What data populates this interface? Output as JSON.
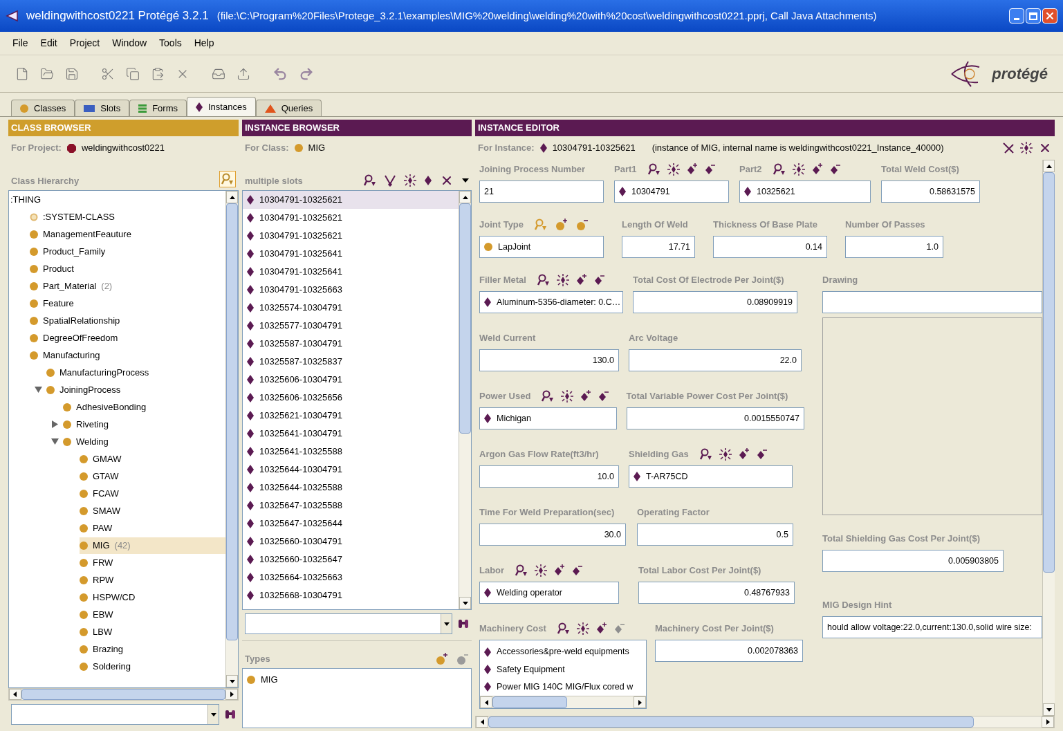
{
  "window": {
    "title": "weldingwithcost0221  Protégé 3.2.1",
    "path": "(file:\\C:\\Program%20Files\\Protege_3.2.1\\examples\\MIG%20welding\\welding%20with%20cost\\weldingwithcost0221.pprj, Call Java Attachments)"
  },
  "menu": [
    "File",
    "Edit",
    "Project",
    "Window",
    "Tools",
    "Help"
  ],
  "logo": "protégé",
  "tabs": [
    {
      "label": "Classes",
      "kind": "classes",
      "selected": false
    },
    {
      "label": "Slots",
      "kind": "slots",
      "selected": false
    },
    {
      "label": "Forms",
      "kind": "forms",
      "selected": false
    },
    {
      "label": "Instances",
      "kind": "instances",
      "selected": true
    },
    {
      "label": "Queries",
      "kind": "queries",
      "selected": false
    }
  ],
  "class_browser": {
    "title": "CLASS BROWSER",
    "for_label": "For Project:",
    "project": "weldingwithcost0221",
    "hierarchy_label": "Class Hierarchy",
    "tree": [
      {
        "label": ":THING",
        "selected": false,
        "children": [
          {
            "label": ":SYSTEM-CLASS",
            "kind": "system",
            "selected": false
          },
          {
            "label": "ManagementFeauture",
            "kind": "class",
            "selected": false
          },
          {
            "label": "Product_Family",
            "kind": "class",
            "selected": false
          },
          {
            "label": "Product",
            "kind": "class",
            "selected": false
          },
          {
            "label": "Part_Material",
            "count": "(2)",
            "kind": "class",
            "selected": false
          },
          {
            "label": "Feature",
            "kind": "class",
            "selected": false
          },
          {
            "label": "SpatialRelationship",
            "kind": "class",
            "selected": false
          },
          {
            "label": "DegreeOfFreedom",
            "kind": "class",
            "selected": false
          },
          {
            "label": "Manufacturing",
            "kind": "class",
            "selected": false,
            "children": [
              {
                "label": "ManufacturingProcess",
                "kind": "class",
                "selected": false
              },
              {
                "label": "JoiningProcess",
                "kind": "class",
                "selected": false,
                "expanded": true,
                "children": [
                  {
                    "label": "AdhesiveBonding",
                    "kind": "class",
                    "selected": false
                  },
                  {
                    "label": "Riveting",
                    "kind": "class",
                    "selected": false,
                    "expanded": false
                  },
                  {
                    "label": "Welding",
                    "kind": "class",
                    "selected": false,
                    "expanded": true,
                    "children": [
                      {
                        "label": "GMAW",
                        "kind": "class",
                        "selected": false
                      },
                      {
                        "label": "GTAW",
                        "kind": "class",
                        "selected": false
                      },
                      {
                        "label": "FCAW",
                        "kind": "class",
                        "selected": false
                      },
                      {
                        "label": "SMAW",
                        "kind": "class",
                        "selected": false
                      },
                      {
                        "label": "PAW",
                        "kind": "class",
                        "selected": false
                      },
                      {
                        "label": "MIG",
                        "count": "(42)",
                        "kind": "class",
                        "selected": true
                      },
                      {
                        "label": "FRW",
                        "kind": "class",
                        "selected": false
                      },
                      {
                        "label": "RPW",
                        "kind": "class",
                        "selected": false
                      },
                      {
                        "label": "HSPW/CD",
                        "kind": "class",
                        "selected": false
                      },
                      {
                        "label": "EBW",
                        "kind": "class",
                        "selected": false
                      },
                      {
                        "label": "LBW",
                        "kind": "class",
                        "selected": false
                      },
                      {
                        "label": "Brazing",
                        "kind": "class",
                        "selected": false
                      },
                      {
                        "label": "Soldering",
                        "kind": "class",
                        "selected": false
                      }
                    ]
                  }
                ]
              }
            ]
          }
        ]
      }
    ]
  },
  "instance_browser": {
    "title": "INSTANCE BROWSER",
    "for_label": "For Class:",
    "class": "MIG",
    "slots_label": "multiple slots",
    "items": [
      {
        "label": "10304791-10325621",
        "selected": true
      },
      {
        "label": "10304791-10325621",
        "selected": false
      },
      {
        "label": "10304791-10325621",
        "selected": false
      },
      {
        "label": "10304791-10325641",
        "selected": false
      },
      {
        "label": "10304791-10325641",
        "selected": false
      },
      {
        "label": "10304791-10325663",
        "selected": false
      },
      {
        "label": "10325574-10304791",
        "selected": false
      },
      {
        "label": "10325577-10304791",
        "selected": false
      },
      {
        "label": "10325587-10304791",
        "selected": false
      },
      {
        "label": "10325587-10325837",
        "selected": false
      },
      {
        "label": "10325606-10304791",
        "selected": false
      },
      {
        "label": "10325606-10325656",
        "selected": false
      },
      {
        "label": "10325621-10304791",
        "selected": false
      },
      {
        "label": "10325641-10304791",
        "selected": false
      },
      {
        "label": "10325641-10325588",
        "selected": false
      },
      {
        "label": "10325644-10304791",
        "selected": false
      },
      {
        "label": "10325644-10325588",
        "selected": false
      },
      {
        "label": "10325647-10325588",
        "selected": false
      },
      {
        "label": "10325647-10325644",
        "selected": false
      },
      {
        "label": "10325660-10304791",
        "selected": false
      },
      {
        "label": "10325660-10325647",
        "selected": false
      },
      {
        "label": "10325664-10325663",
        "selected": false
      },
      {
        "label": "10325668-10304791",
        "selected": false
      }
    ],
    "types_label": "Types",
    "types": [
      "MIG"
    ]
  },
  "editor": {
    "title": "INSTANCE EDITOR",
    "for_label": "For Instance:",
    "instance": "10304791-10325621",
    "note": "(instance of MIG, internal name is weldingwithcost0221_Instance_40000)",
    "top_rows": [
      [
        {
          "label": "Joining Process Number",
          "kind": "text",
          "value": "21"
        },
        {
          "label": "Part1",
          "kind": "instance",
          "value": "10304791",
          "remove_enabled": true
        },
        {
          "label": "Part2",
          "kind": "instance",
          "value": "10325621",
          "remove_enabled": true
        },
        {
          "label": "Total Weld Cost($)",
          "kind": "number",
          "value": "0.58631575"
        }
      ],
      [
        {
          "label": "Joint Type",
          "kind": "class",
          "value": "LapJoint"
        },
        {
          "label": "Length Of Weld",
          "kind": "number",
          "value": "17.71"
        },
        {
          "label": "Thickness Of Base Plate",
          "kind": "number",
          "value": "0.14"
        },
        {
          "label": "Number Of Passes",
          "kind": "number",
          "value": "1.0"
        }
      ]
    ],
    "left_rows": [
      [
        {
          "label": "Filler Metal",
          "kind": "instance",
          "value": "Aluminum-5356-diameter: 0.C…",
          "remove_enabled": true
        },
        {
          "label": "Total Cost Of Electrode Per Joint($)",
          "kind": "number",
          "value": "0.08909919"
        }
      ],
      [
        {
          "label": "Weld Current",
          "kind": "number",
          "value": "130.0"
        },
        {
          "label": "Arc Voltage",
          "kind": "number",
          "value": "22.0"
        }
      ],
      [
        {
          "label": "Power Used",
          "kind": "instance",
          "value": "Michigan",
          "remove_enabled": true
        },
        {
          "label": "Total Variable Power Cost Per Joint($)",
          "kind": "number",
          "value": "0.0015550747"
        }
      ],
      [
        {
          "label": "Argon Gas Flow Rate(ft3/hr)",
          "kind": "number",
          "value": "10.0"
        },
        {
          "label": "Shielding Gas",
          "kind": "instance",
          "value": "T-AR75CD",
          "remove_enabled": true
        }
      ],
      [
        {
          "label": "Time For Weld Preparation(sec)",
          "kind": "number",
          "value": "30.0"
        },
        {
          "label": "Operating Factor",
          "kind": "number",
          "value": "0.5"
        }
      ],
      [
        {
          "label": "Labor",
          "kind": "instance",
          "value": "Welding operator",
          "remove_enabled": true
        },
        {
          "label": "Total Labor Cost Per Joint($)",
          "kind": "number",
          "value": "0.48767933"
        }
      ],
      [
        {
          "label": "Machinery Cost",
          "kind": "list",
          "values": [
            "Accessories&pre-weld equipments",
            "Safety Equipment",
            "Power MIG 140C MIG/Flux cored w"
          ],
          "remove_enabled": false
        },
        {
          "label": "Machinery Cost Per Joint($)",
          "kind": "number",
          "value": "0.002078363"
        }
      ]
    ],
    "right_fields": [
      {
        "label": "Drawing",
        "kind": "image"
      },
      {
        "label": "Total Shielding Gas Cost Per Joint($)",
        "kind": "number",
        "value": "0.005903805"
      },
      {
        "label": "MIG Design Hint",
        "kind": "text",
        "value": "hould allow voltage:22.0,current:130.0,solid wire size:"
      }
    ]
  }
}
